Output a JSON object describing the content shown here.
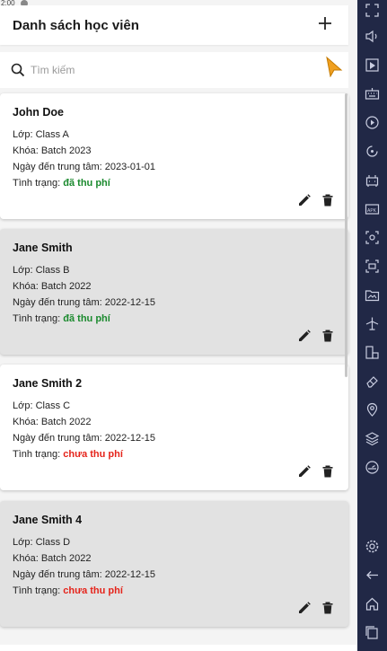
{
  "status_bar": {
    "time": "2:00"
  },
  "header": {
    "title": "Danh sách học viên"
  },
  "search": {
    "placeholder": "Tìm kiếm"
  },
  "labels": {
    "class": "Lớp: ",
    "batch": "Khóa: ",
    "date": "Ngày đến trung tâm: ",
    "status": "Tình trạng: "
  },
  "students": [
    {
      "name": "John Doe",
      "class": "Class A",
      "batch": "Batch 2023",
      "date": "2023-01-01",
      "status": "đã thu phí",
      "paid": true
    },
    {
      "name": "Jane Smith",
      "class": "Class B",
      "batch": "Batch 2022",
      "date": "2022-12-15",
      "status": "đã thu phí",
      "paid": true
    },
    {
      "name": "Jane Smith 2",
      "class": "Class C",
      "batch": "Batch 2022",
      "date": "2022-12-15",
      "status": "chưa thu phí",
      "paid": false
    },
    {
      "name": "Jane Smith 4",
      "class": "Class D",
      "batch": "Batch 2022",
      "date": "2022-12-15",
      "status": "chưa thu phí",
      "paid": false
    }
  ],
  "icons": {
    "header": [
      "add-icon"
    ],
    "search": [
      "search-icon"
    ],
    "card_actions": [
      "edit-icon",
      "delete-icon"
    ],
    "emulator_toolbar": [
      "fullscreen-icon",
      "volume-icon",
      "media-icon",
      "keyboard-icon",
      "play-icon",
      "rotate-icon",
      "robot-icon",
      "apk-icon",
      "screenshot-icon",
      "record-icon",
      "gallery-icon",
      "airplane-icon",
      "multi-window-icon",
      "eraser-icon",
      "location-icon",
      "layers-icon",
      "speed-icon",
      "settings-icon",
      "back-icon",
      "home-icon",
      "recent-apps-icon"
    ]
  },
  "colors": {
    "paid": "#1b8a2e",
    "unpaid": "#e5241b",
    "toolbar_bg": "#212846",
    "cursor": "#f0a020"
  }
}
